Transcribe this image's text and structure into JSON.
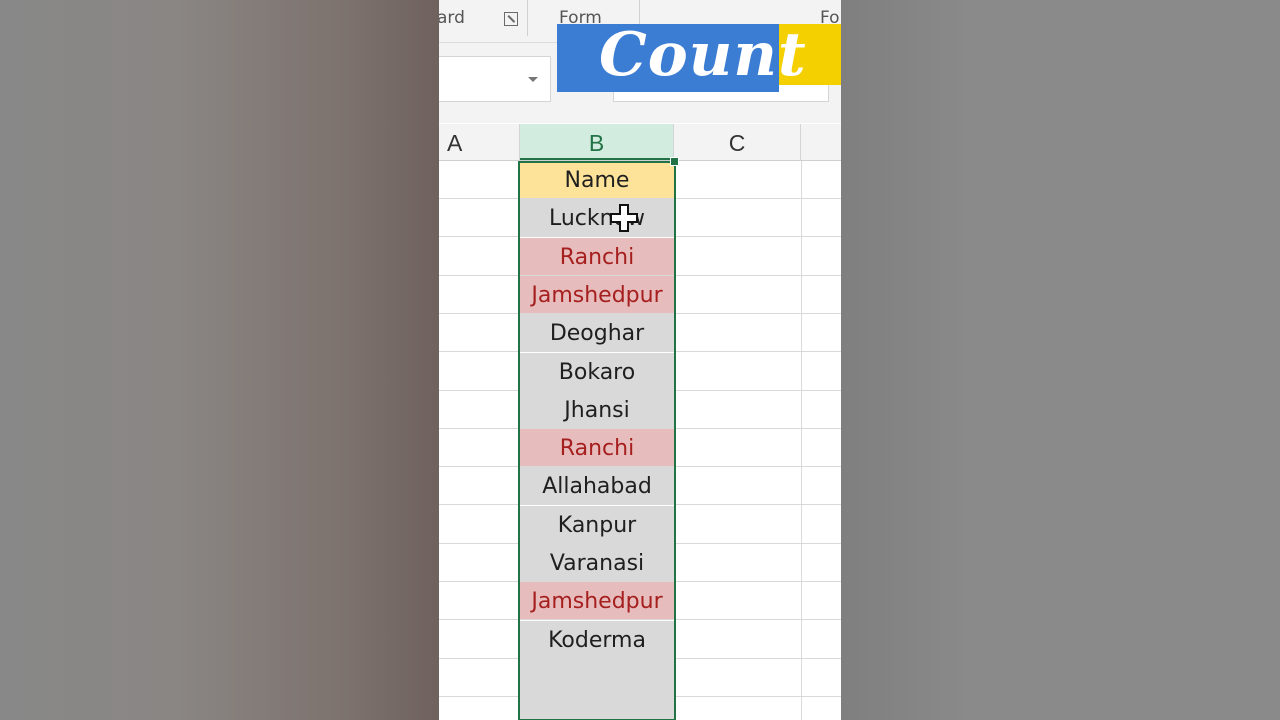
{
  "overlay_title": "Count",
  "ribbon": {
    "group_left": "ard",
    "group_mid": "Form",
    "group_right": "Fo"
  },
  "columns": [
    "A",
    "B",
    "C"
  ],
  "rows": [
    {
      "value": "Name",
      "fill": "#fde39a",
      "color": "#1f1f1f"
    },
    {
      "value": "Lucknow",
      "fill": "#d9d9d9",
      "color": "#1f1f1f"
    },
    {
      "value": "Ranchi",
      "fill": "#e7bcbc",
      "color": "#a61f1f"
    },
    {
      "value": "Jamshedpur",
      "fill": "#e7bcbc",
      "color": "#a61f1f"
    },
    {
      "value": "Deoghar",
      "fill": "#d9d9d9",
      "color": "#1f1f1f"
    },
    {
      "value": "Bokaro",
      "fill": "#d9d9d9",
      "color": "#1f1f1f"
    },
    {
      "value": "Jhansi",
      "fill": "#d9d9d9",
      "color": "#1f1f1f"
    },
    {
      "value": "Ranchi",
      "fill": "#e7bcbc",
      "color": "#a61f1f"
    },
    {
      "value": "Allahabad",
      "fill": "#d9d9d9",
      "color": "#1f1f1f"
    },
    {
      "value": "Kanpur",
      "fill": "#d9d9d9",
      "color": "#1f1f1f"
    },
    {
      "value": "Varanasi",
      "fill": "#d9d9d9",
      "color": "#1f1f1f"
    },
    {
      "value": "Jamshedpur",
      "fill": "#e7bcbc",
      "color": "#a61f1f"
    },
    {
      "value": "Koderma",
      "fill": "#d9d9d9",
      "color": "#1f1f1f"
    },
    {
      "value": "",
      "fill": "#d9d9d9",
      "color": "#1f1f1f"
    },
    {
      "value": "",
      "fill": "#d9d9d9",
      "color": "#1f1f1f"
    }
  ],
  "colors": {
    "selection": "#217346",
    "duplicate_fill": "#e7bcbc",
    "duplicate_text": "#a61f1f",
    "header_fill": "#fde39a"
  },
  "icons": {
    "cursor": "plus-cursor-icon",
    "launcher": "dialog-launcher-icon",
    "namebox_dropdown": "chevron-down-icon"
  }
}
